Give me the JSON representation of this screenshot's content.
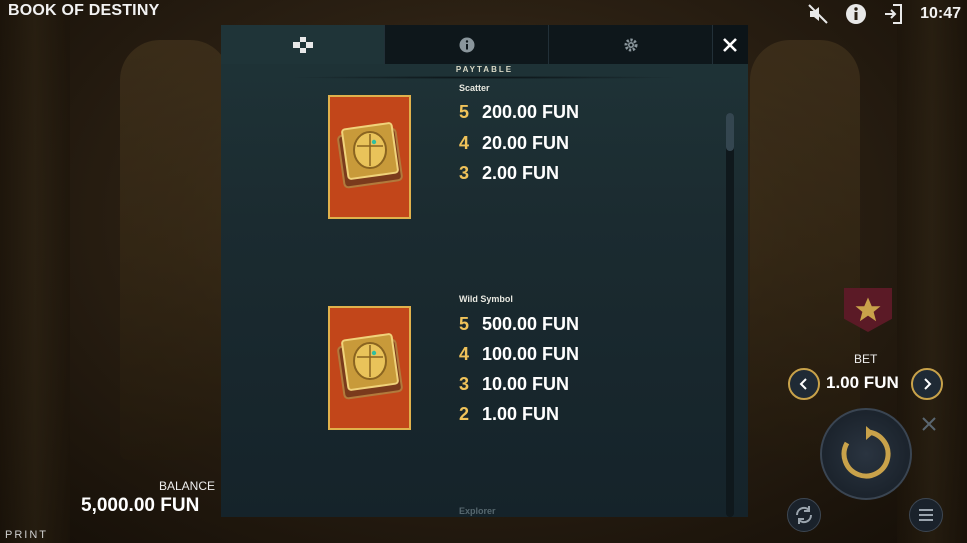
{
  "game": {
    "title": "BOOK OF DESTINY",
    "clock": "10:47"
  },
  "topbar_icons": [
    "sound-muted-icon",
    "info-icon",
    "exit-icon"
  ],
  "balance": {
    "label": "BALANCE",
    "value": "5,000.00 FUN"
  },
  "print_label": "PRINT",
  "bet": {
    "label": "BET",
    "value": "1.00 FUN"
  },
  "colors": {
    "accent_gold": "#f0c35a",
    "modal_bg": "#1b2b30",
    "tile_red": "#c2461a",
    "tile_border": "#e0b14c"
  },
  "modal": {
    "tabs": [
      {
        "icon": "paytable-icon",
        "active": true
      },
      {
        "icon": "info-icon",
        "active": false
      },
      {
        "icon": "gear-icon",
        "active": false
      }
    ],
    "section_title": "PAYTABLE",
    "symbols": [
      {
        "name": "Scatter",
        "icon": "book-scarab-icon",
        "pays": [
          {
            "count": "5",
            "amount": "200.00 FUN"
          },
          {
            "count": "4",
            "amount": "20.00 FUN"
          },
          {
            "count": "3",
            "amount": "2.00 FUN"
          }
        ]
      },
      {
        "name": "Wild Symbol",
        "icon": "book-scarab-icon",
        "pays": [
          {
            "count": "5",
            "amount": "500.00 FUN"
          },
          {
            "count": "4",
            "amount": "100.00 FUN"
          },
          {
            "count": "3",
            "amount": "10.00 FUN"
          },
          {
            "count": "2",
            "amount": "1.00 FUN"
          }
        ]
      }
    ],
    "next_symbol_label": "Explorer"
  }
}
